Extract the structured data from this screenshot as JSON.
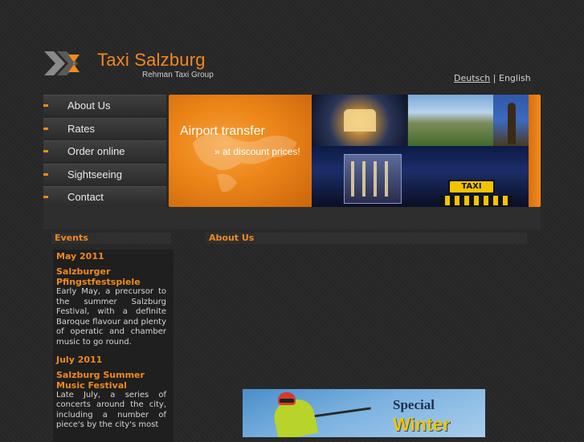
{
  "header": {
    "title": "Taxi Salzburg",
    "subtitle": "Rehman Taxi Group",
    "logo_icon": "taxi-logo-icon",
    "languages": {
      "german": "Deutsch",
      "separator": "|",
      "english": "English"
    }
  },
  "nav": {
    "items": [
      {
        "label": "About Us"
      },
      {
        "label": "Rates"
      },
      {
        "label": "Order online"
      },
      {
        "label": "Sightseeing"
      },
      {
        "label": "Contact"
      }
    ]
  },
  "banner": {
    "headline": "Airport transfer",
    "tagline": "» at discount prices!",
    "taxi_sign": "TAXI"
  },
  "sidebar": {
    "heading": "Events",
    "events": [
      {
        "month": "May 2011",
        "title": "Salzburger Pfingstfestspiele",
        "text": "Early May, a precursor to the summer Salzburg Festival, with a definite Baroque flavour and plenty of operatic and chamber music to go round."
      },
      {
        "month": "July 2011",
        "title": "Salzburg Summer Music Festival",
        "text": "Late July, a series of concerts around the city, including a number of piece's by the city's most"
      }
    ]
  },
  "main": {
    "heading": "About Us"
  },
  "ad": {
    "line1": "Special",
    "line2": "Winter"
  },
  "colors": {
    "accent": "#f08a1c",
    "background": "#262626",
    "panel": "#2f2f2f"
  }
}
